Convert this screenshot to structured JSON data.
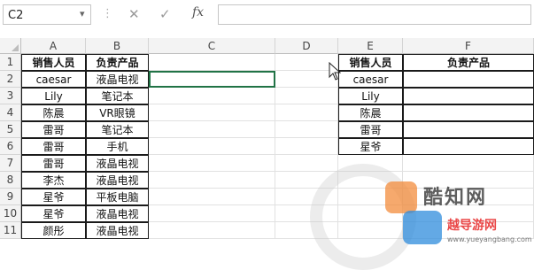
{
  "formula_bar": {
    "name_box": "C2",
    "cancel_icon": "✕",
    "enter_icon": "✓",
    "fx_label": "fx",
    "formula": ""
  },
  "columns": [
    "A",
    "B",
    "C",
    "D",
    "E",
    "F"
  ],
  "rows": [
    "1",
    "2",
    "3",
    "4",
    "5",
    "6",
    "7",
    "8",
    "9",
    "10",
    "11"
  ],
  "table1": {
    "headers": [
      "销售人员",
      "负责产品"
    ],
    "rows": [
      [
        "caesar",
        "液晶电视"
      ],
      [
        "Lily",
        "笔记本"
      ],
      [
        "陈晨",
        "VR眼镜"
      ],
      [
        "雷哥",
        "笔记本"
      ],
      [
        "雷哥",
        "手机"
      ],
      [
        "雷哥",
        "液晶电视"
      ],
      [
        "李杰",
        "液晶电视"
      ],
      [
        "星爷",
        "平板电脑"
      ],
      [
        "星爷",
        "液晶电视"
      ],
      [
        "颜彤",
        "液晶电视"
      ]
    ]
  },
  "table2": {
    "headers": [
      "销售人员",
      "负责产品"
    ],
    "rows": [
      [
        "caesar",
        ""
      ],
      [
        "Lily",
        ""
      ],
      [
        "陈晨",
        ""
      ],
      [
        "雷哥",
        ""
      ],
      [
        "星爷",
        ""
      ]
    ]
  },
  "watermark": {
    "brand1": "酷知网",
    "brand2": "越导游网",
    "url": "www.yueyangbang.com"
  }
}
